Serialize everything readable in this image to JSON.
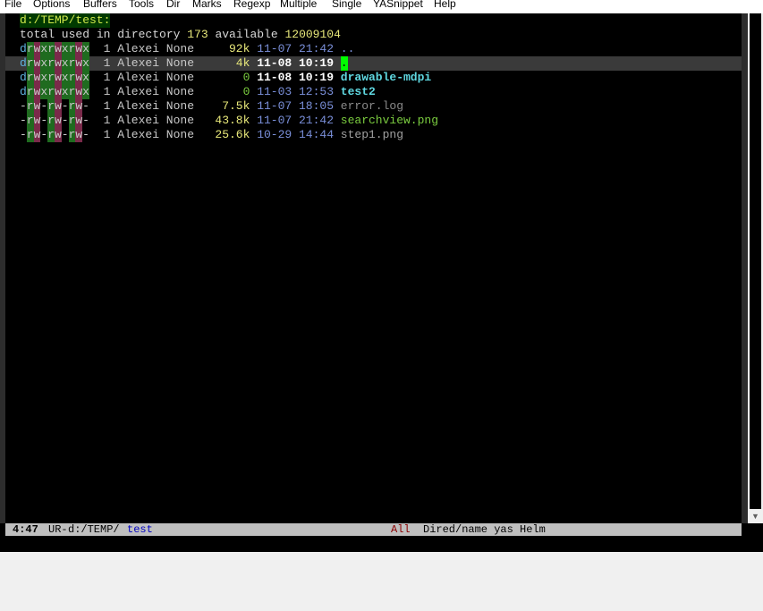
{
  "menu": [
    "File",
    "Options",
    "Buffers",
    "Tools",
    "Dir",
    "Marks",
    "Regexp",
    "Multiple",
    "Single",
    "YASnippet",
    "Help"
  ],
  "dired": {
    "header": "d:/TEMP/test:",
    "total_prefix": "total used in directory ",
    "total_used": "173",
    "available_label": " available ",
    "available_value": "12009104",
    "rows": [
      {
        "perms": "drwxrwxrwx",
        "links": "1",
        "owner": "Alexei",
        "group": "None",
        "size": "92k",
        "date": "11-07 21:42",
        "name": "..",
        "name_style": "name-dot",
        "size_style": "size-yellow",
        "date_style": "date-blue"
      },
      {
        "perms": "drwxrwxrwx",
        "links": "1",
        "owner": "Alexei",
        "group": "None",
        "size": "4k",
        "date": "11-08 10:19",
        "name": ".",
        "name_style": "cursor",
        "size_style": "size-yellow",
        "date_style": "date-bold"
      },
      {
        "perms": "drwxrwxrwx",
        "links": "1",
        "owner": "Alexei",
        "group": "None",
        "size": "0",
        "date": "11-08 10:19",
        "name": "drawable-mdpi",
        "name_style": "name-dir",
        "size_style": "size-green",
        "date_style": "date-bold"
      },
      {
        "perms": "drwxrwxrwx",
        "links": "1",
        "owner": "Alexei",
        "group": "None",
        "size": "0",
        "date": "11-03 12:53",
        "name": "test2",
        "name_style": "name-dir",
        "size_style": "size-green",
        "date_style": "date-blue"
      },
      {
        "perms": "-rw-rw-rw-",
        "links": "1",
        "owner": "Alexei",
        "group": "None",
        "size": "7.5k",
        "date": "11-07 18:05",
        "name": "error.log",
        "name_style": "name-log",
        "size_style": "size-yellow",
        "date_style": "date-blue"
      },
      {
        "perms": "-rw-rw-rw-",
        "links": "1",
        "owner": "Alexei",
        "group": "None",
        "size": "43.8k",
        "date": "11-07 21:42",
        "name": "searchview.png",
        "name_style": "name-png",
        "size_style": "size-yellow",
        "date_style": "date-blue"
      },
      {
        "perms": "-rw-rw-rw-",
        "links": "1",
        "owner": "Alexei",
        "group": "None",
        "size": "25.6k",
        "date": "10-29 14:44",
        "name": "step1.png",
        "name_style": "name-png2",
        "size_style": "size-yellow",
        "date_style": "date-blue"
      }
    ]
  },
  "modeline": {
    "position": "4:47",
    "state": "UR-",
    "path": "d:/TEMP/",
    "buffer": "test",
    "scope": "All",
    "modes": "Dired/name yas Helm"
  },
  "colors": {
    "background": "#000000",
    "cursor": "#00ff00",
    "header_fg": "#cfe84a",
    "dir_name": "#5fd7e0"
  }
}
